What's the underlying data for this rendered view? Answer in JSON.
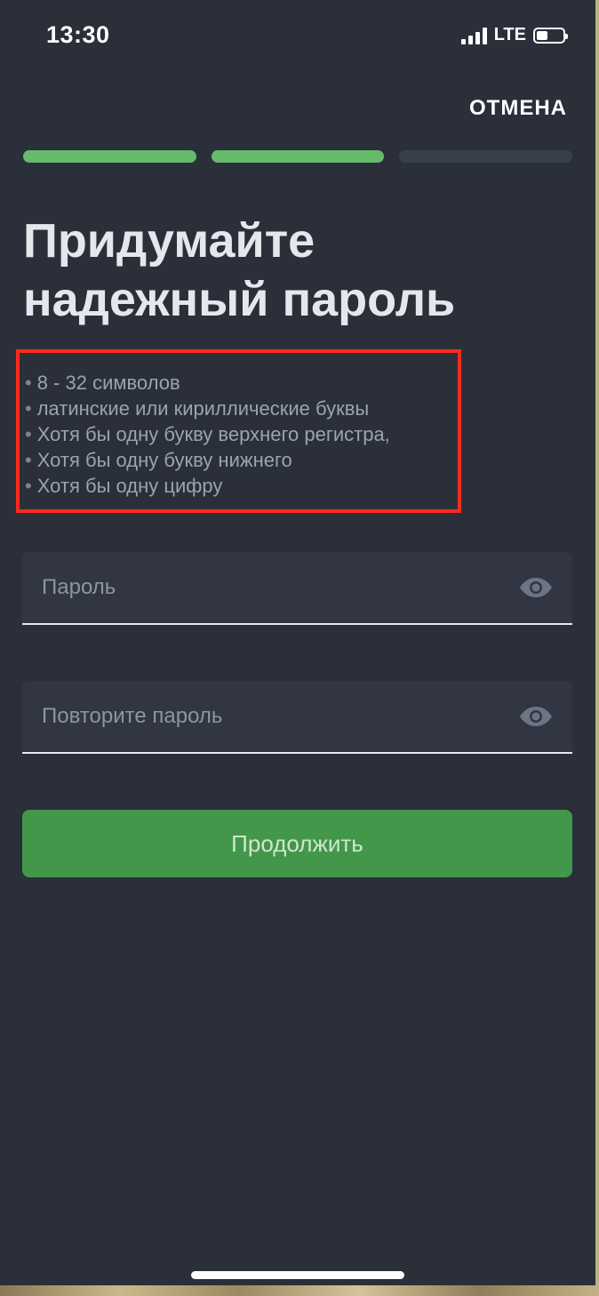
{
  "status_bar": {
    "time": "13:30",
    "network": "LTE"
  },
  "header": {
    "cancel_label": "ОТМЕНА"
  },
  "progress": {
    "steps_total": 3,
    "steps_completed": 2,
    "active_color": "#66bb6a",
    "inactive_color": "#38404d"
  },
  "title": {
    "line1": "Придумайте",
    "line2": "надежный пароль"
  },
  "requirements": [
    "8 - 32 символов",
    "латинские или кириллические буквы",
    "Хотя бы одну букву верхнего регистра,",
    "Хотя бы одну букву нижнего",
    "Хотя бы одну цифру"
  ],
  "fields": {
    "password": {
      "placeholder": "Пароль",
      "value": "",
      "icon": "eye-icon"
    },
    "repeat_password": {
      "placeholder": "Повторите пароль",
      "value": "",
      "icon": "eye-icon"
    }
  },
  "continue_button": {
    "label": "Продолжить",
    "color": "#43974a"
  },
  "highlight_color": "#ff2a1a"
}
